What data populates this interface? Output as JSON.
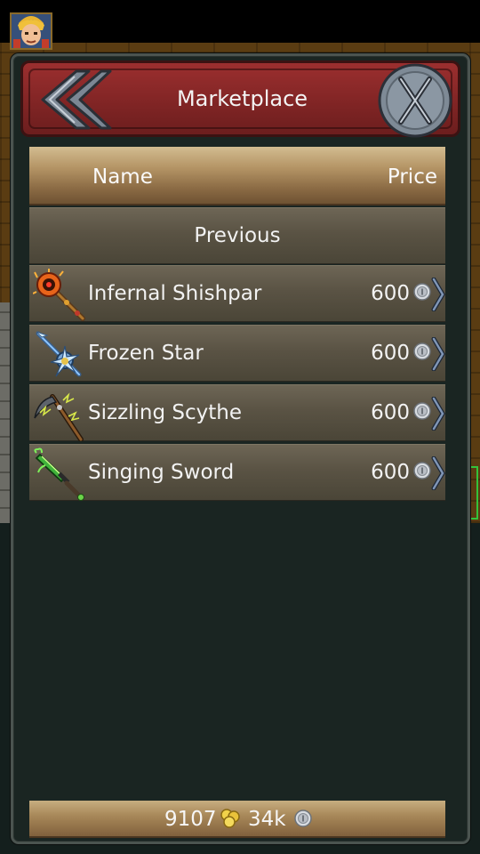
{
  "market": {
    "title": "Marketplace",
    "columns": {
      "name": "Name",
      "price": "Price"
    },
    "previous_label": "Previous",
    "items": [
      {
        "name": "Infernal Shishpar",
        "price": "600",
        "icon": "infernal-shishpar-icon"
      },
      {
        "name": "Frozen Star",
        "price": "600",
        "icon": "frozen-star-icon"
      },
      {
        "name": "Sizzling Scythe",
        "price": "600",
        "icon": "sizzling-scythe-icon"
      },
      {
        "name": "Singing Sword",
        "price": "600",
        "icon": "singing-sword-icon"
      }
    ]
  },
  "footer": {
    "gold": "9107",
    "silver": "34k"
  },
  "colors": {
    "title_bar": "#8b2a2a",
    "header": "#b59566",
    "row": "#5a5344",
    "panel": "#1a2522"
  }
}
